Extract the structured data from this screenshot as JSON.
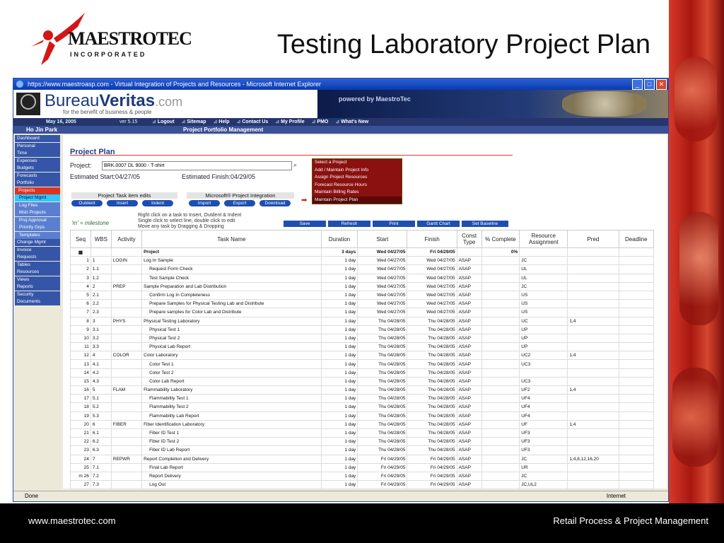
{
  "slide": {
    "title": "Testing Laboratory Project Plan",
    "logo_main": "MAESTROTEC",
    "logo_sub": "INCORPORATED",
    "footer_left": "www.maestrotec.com",
    "footer_right": "Retail Process &  Project Management"
  },
  "browser": {
    "title": "https://www.maestroasp.com - Virtual Integration of Projects and Resources - Microsoft Internet Explorer",
    "status_left": "Done",
    "status_right": "Internet"
  },
  "app": {
    "brand_a": "Bureau",
    "brand_b": "Veritas",
    "brand_c": ".com",
    "tagline": "for the benefit of business & people",
    "powered": "powered by MaestroTec",
    "date": "May 16, 2005",
    "version": "ver 5.15",
    "nav": [
      "Logout",
      "Sitemap",
      "Help",
      "Contact Us",
      "My Profile",
      "PMO",
      "What's New"
    ],
    "user": "Ho Jin Park",
    "section": "Project Portfolio Management"
  },
  "sidebar": [
    "Dashboard",
    "Personal",
    "Time",
    "Expenses",
    "Budgets",
    "Forecasts",
    "Portfolio",
    "Projects",
    "Project Mgmt",
    "Log Files",
    "Mstr Projects",
    "Proj Approval",
    "Priority Grps",
    "Templates",
    "Change Mgmt",
    "Invoice",
    "Requests",
    "Tables",
    "Resources",
    "Views",
    "Reports",
    "Security",
    "Documents"
  ],
  "plan": {
    "heading": "Project Plan",
    "project_label": "Project:",
    "project_value": "BRK.0007 DL 9000 - T-shirt",
    "est_start": "Estimated Start:04/27/05",
    "est_finish": "Estimated Finish:04/29/05",
    "menu": [
      "Select a Project",
      "Add / Maintain Project Info",
      "Assign Project Resources",
      "Forecast Resource Hours",
      "Maintain Billing Rates",
      "Maintain Project Plan"
    ],
    "edits_title": "Project Task item edits",
    "edits": [
      "Outdent",
      "Insert",
      "Indent"
    ],
    "msp_title": "Microsoft® Project Integration",
    "msp": [
      "Import",
      "Export",
      "Download"
    ],
    "milestone": "'m' = milestone",
    "hints": [
      "Right click on a task to Insert, Outdent & Indent",
      "Single click to select line, double click to edit",
      "Move any task by Dragging & Dropping"
    ],
    "actions": [
      "Save",
      "Refresh",
      "Print",
      "Gantt Chart",
      "Set Baseline"
    ],
    "columns": [
      "Seq",
      "WBS",
      "Activity",
      "Task Name",
      "Duration",
      "Start",
      "Finish",
      "Const Type",
      "% Complete",
      "Resource Assignment",
      "Pred",
      "Deadline"
    ],
    "summary": {
      "task": "Project",
      "duration": "3 days",
      "start": "Wed 04/27/05",
      "finish": "Fri 04/29/05",
      "complete": "0%"
    },
    "rows": [
      [
        "1",
        "1",
        "LOGIN",
        "Log In Sample",
        "1 day",
        "Wed 04/27/05",
        "Wed 04/27/05",
        "ASAP",
        "",
        "JC",
        "",
        ""
      ],
      [
        "2",
        "1.1",
        "",
        "Request Form Check",
        "1 day",
        "Wed 04/27/05",
        "Wed 04/27/05",
        "ASAP",
        "",
        "UL",
        "",
        ""
      ],
      [
        "3",
        "1.2",
        "",
        "Test Sample Check",
        "1 day",
        "Wed 04/27/05",
        "Wed 04/27/05",
        "ASAP",
        "",
        "UL",
        "",
        ""
      ],
      [
        "4",
        "2",
        "PREP",
        "Sample Preparation and Lab Distribution",
        "1 day",
        "Wed 04/27/05",
        "Wed 04/27/05",
        "ASAP",
        "",
        "JC",
        "",
        ""
      ],
      [
        "5",
        "2.1",
        "",
        "Confirm Log In Completeness",
        "1 day",
        "Wed 04/27/05",
        "Wed 04/27/05",
        "ASAP",
        "",
        "US",
        "",
        ""
      ],
      [
        "6",
        "2.2",
        "",
        "Prepare Samples for Physical Testing Lab and Distribute",
        "1 day",
        "Wed 04/27/05",
        "Wed 04/27/05",
        "ASAP",
        "",
        "US",
        "",
        ""
      ],
      [
        "7",
        "2.3",
        "",
        "Prepare samples for Color Lab and Distribute",
        "1 day",
        "Wed 04/27/05",
        "Wed 04/27/05",
        "ASAP",
        "",
        "US",
        "",
        ""
      ],
      [
        "8",
        "3",
        "PHYS",
        "Physical Testing Laboratory",
        "1 day",
        "Thu 04/28/05",
        "Thu 04/28/05",
        "ASAP",
        "",
        "UC",
        "1,4",
        ""
      ],
      [
        "9",
        "3.1",
        "",
        "Physical Test 1",
        "1 day",
        "Thu 04/28/05",
        "Thu 04/28/05",
        "ASAP",
        "",
        "UP",
        "",
        ""
      ],
      [
        "10",
        "3.2",
        "",
        "Physical Test 2",
        "1 day",
        "Thu 04/28/05",
        "Thu 04/28/05",
        "ASAP",
        "",
        "UP",
        "",
        ""
      ],
      [
        "11",
        "3.3",
        "",
        "Physical Lab Report",
        "1 day",
        "Thu 04/28/05",
        "Thu 04/28/05",
        "ASAP",
        "",
        "UP",
        "",
        ""
      ],
      [
        "12",
        "4",
        "COLOR",
        "Color Laboratory",
        "1 day",
        "Thu 04/28/05",
        "Thu 04/28/05",
        "ASAP",
        "",
        "UC2",
        "1,4",
        ""
      ],
      [
        "13",
        "4.1",
        "",
        "Color Test 1",
        "1 day",
        "Thu 04/28/05",
        "Thu 04/28/05",
        "ASAP",
        "",
        "UC3",
        "",
        ""
      ],
      [
        "14",
        "4.2",
        "",
        "Color Test 2",
        "1 day",
        "Thu 04/28/05",
        "Thu 04/28/05",
        "ASAP",
        "",
        "",
        "",
        ""
      ],
      [
        "15",
        "4.3",
        "",
        "Color Lab Report",
        "1 day",
        "Thu 04/28/05",
        "Thu 04/28/05",
        "ASAP",
        "",
        "UC3",
        "",
        ""
      ],
      [
        "16",
        "5",
        "FLAM",
        "Flammability Laboratory",
        "1 day",
        "Thu 04/28/05",
        "Thu 04/28/05",
        "ASAP",
        "",
        "UF2",
        "1,4",
        ""
      ],
      [
        "17",
        "5.1",
        "",
        "Flammability Test 1",
        "1 day",
        "Thu 04/28/05",
        "Thu 04/28/05",
        "ASAP",
        "",
        "UF4",
        "",
        ""
      ],
      [
        "18",
        "5.2",
        "",
        "Flammability Test 2",
        "1 day",
        "Thu 04/28/05",
        "Thu 04/28/05",
        "ASAP",
        "",
        "UF4",
        "",
        ""
      ],
      [
        "19",
        "5.3",
        "",
        "Flammability Lab Report",
        "1 day",
        "Thu 04/28/05",
        "Thu 04/28/05",
        "ASAP",
        "",
        "UF4",
        "",
        ""
      ],
      [
        "20",
        "6",
        "FIBER",
        "Fiber Identification Laboratory",
        "1 day",
        "Thu 04/28/05",
        "Thu 04/28/05",
        "ASAP",
        "",
        "UF",
        "1,4",
        ""
      ],
      [
        "21",
        "6.1",
        "",
        "Fiber ID Test 1",
        "1 day",
        "Thu 04/28/05",
        "Thu 04/28/05",
        "ASAP",
        "",
        "UF3",
        "",
        ""
      ],
      [
        "22",
        "6.2",
        "",
        "Fiber ID Test 2",
        "1 day",
        "Thu 04/28/05",
        "Thu 04/28/05",
        "ASAP",
        "",
        "UF3",
        "",
        ""
      ],
      [
        "23",
        "6.3",
        "",
        "Fiber ID Lab Report",
        "1 day",
        "Thu 04/28/05",
        "Thu 04/28/05",
        "ASAP",
        "",
        "UF3",
        "",
        ""
      ],
      [
        "24",
        "7",
        "REPWR",
        "Report Completion and Delivery",
        "1 day",
        "Fri 04/29/05",
        "Fri 04/29/05",
        "ASAP",
        "",
        "JC",
        "1,4,8,12,16,20",
        ""
      ],
      [
        "25",
        "7.1",
        "",
        "Final Lab Report",
        "1 day",
        "Fri 04/29/05",
        "Fri 04/29/05",
        "ASAP",
        "",
        "UR",
        "",
        ""
      ],
      [
        "m 26",
        "7.2",
        "",
        "Report Delivery",
        "1 day",
        "Fri 04/29/05",
        "Fri 04/29/05",
        "ASAP",
        "",
        "JC",
        "",
        ""
      ],
      [
        "27",
        "7.3",
        "",
        "Log Out",
        "1 day",
        "Fri 04/29/05",
        "Fri 04/29/05",
        "ASAP",
        "",
        "JC,UL2",
        "",
        ""
      ]
    ]
  }
}
